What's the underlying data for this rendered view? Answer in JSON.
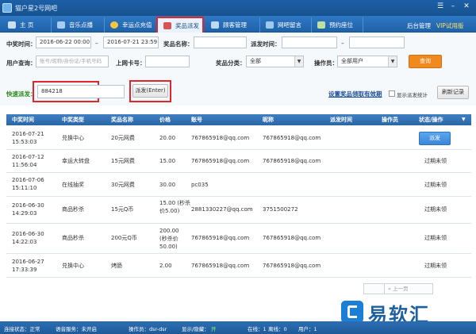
{
  "window": {
    "title": "猫户星2号网吧"
  },
  "nav": {
    "tabs": [
      {
        "label": "主  页",
        "icon": "home-icon"
      },
      {
        "label": "音乐点播",
        "icon": "music-icon"
      },
      {
        "label": "幸运点充值",
        "icon": "coin-icon"
      },
      {
        "label": "奖品派发",
        "icon": "gift-icon"
      },
      {
        "label": "顾客管理",
        "icon": "monitor-icon"
      },
      {
        "label": "网吧留言",
        "icon": "message-icon"
      },
      {
        "label": "预约座位",
        "icon": "seat-icon"
      }
    ],
    "backend": "后台管理",
    "vip": "VIP试用版"
  },
  "filter": {
    "win_time_label": "中奖时间：",
    "date_from": "2016-06-22 00:00",
    "dash": "–",
    "date_to": "2016-07-21 23:59",
    "prize_name_label": "奖品名称：",
    "dispatch_time_label": "派发时间：",
    "dash2": "–",
    "user_query_label": "用户查询：",
    "user_query_placeholder": "账号/昵称/身份证/手机号码",
    "card_label": "上网卡号：",
    "category_label": "奖品分类：",
    "category_value": "全部",
    "operator_label": "操作员：",
    "operator_value": "全部用户",
    "query_button": "查询"
  },
  "quick": {
    "label": "快速派发：",
    "code": "884218",
    "dispatch_button": "派发(Enter)",
    "settings_link": "设置奖品领取有效期",
    "show_stats_label": "显示派发统计",
    "refresh_button": "刷新记录"
  },
  "table": {
    "headers": [
      "中奖时间",
      "中奖类型",
      "奖品名称",
      "价格",
      "账号",
      "昵称",
      "派发时间",
      "操作员",
      "状态/操作"
    ],
    "rows": [
      {
        "time1": "2016-07-21",
        "time2": "15:53:03",
        "type": "兑换中心",
        "prize": "20元网费",
        "price": "20.00",
        "account": "767865918@qq.com",
        "nickname": "767865918@qq.com",
        "status": "派发",
        "is_button": true
      },
      {
        "time1": "2016-07-12",
        "time2": "11:56:04",
        "type": "幸运大转盘",
        "prize": "15元网费",
        "price": "15.00",
        "account": "767865918@qq.com",
        "nickname": "767865918@qq.com",
        "status": "过期未领",
        "is_button": false
      },
      {
        "time1": "2016-07-06",
        "time2": "15:11:10",
        "type": "在线抽奖",
        "prize": "30元网费",
        "price": "30.00",
        "account": "pc035",
        "nickname": "",
        "status": "过期未领",
        "is_button": false
      },
      {
        "time1": "2016-06-30",
        "time2": "14:29:03",
        "type": "商品秒杀",
        "prize": "15元Q币",
        "price": "15.00 (秒杀价5.00)",
        "account": "2881330227@qq.com",
        "nickname": "3751500272",
        "status": "过期未领",
        "is_button": false
      },
      {
        "time1": "2016-06-30",
        "time2": "14:22:03",
        "type": "商品秒杀",
        "prize": "200元Q币",
        "price": "200.00 (秒杀价50.00)",
        "account": "767865918@qq.com",
        "nickname": "767865918@qq.com",
        "status": "过期未领",
        "is_button": false
      },
      {
        "time1": "2016-06-27",
        "time2": "17:33:39",
        "type": "兑换中心",
        "prize": "烤肠",
        "price": "2.00",
        "account": "767865918@qq.com",
        "nickname": "767865918@qq.com",
        "status": "过期未领",
        "is_button": false
      }
    ]
  },
  "pager": {
    "prev": "« 上一页"
  },
  "status": {
    "connection": "连接状态：正常",
    "voice": "语音服务：未开启",
    "operator": "操作员：dsr-dsr",
    "show_hide": "显示/隐藏：",
    "show_hide_value": "开",
    "online": "在线：1",
    "offline": "离线：0",
    "users": "用户：1"
  },
  "watermark": {
    "text": "易软汇"
  }
}
